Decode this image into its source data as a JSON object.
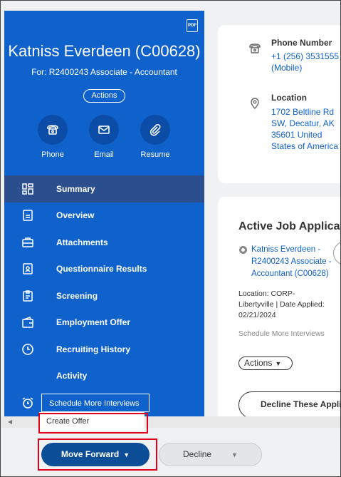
{
  "candidate": {
    "pdf_label": "PDF",
    "name": "Katniss Everdeen (C00628)",
    "for_line": "For: R2400243 Associate - Accountant",
    "actions_label": "Actions",
    "contact_buttons": [
      {
        "label": "Phone",
        "icon": "phone-icon"
      },
      {
        "label": "Email",
        "icon": "email-icon"
      },
      {
        "label": "Resume",
        "icon": "paperclip-icon"
      }
    ]
  },
  "nav": {
    "items": [
      {
        "label": "Summary",
        "icon": "grid-icon",
        "active": true
      },
      {
        "label": "Overview",
        "icon": "document-icon"
      },
      {
        "label": "Attachments",
        "icon": "briefcase-icon"
      },
      {
        "label": "Questionnaire Results",
        "icon": "person-card-icon"
      },
      {
        "label": "Screening",
        "icon": "clipboard-icon"
      },
      {
        "label": "Employment Offer",
        "icon": "wallet-icon"
      },
      {
        "label": "Recruiting History",
        "icon": "clock-icon"
      },
      {
        "label": "Activity",
        "icon": ""
      },
      {
        "label": "",
        "icon": "alarm-clock-icon"
      }
    ]
  },
  "popup": {
    "item1": "Schedule More Interviews",
    "item2": "Create Offer"
  },
  "contact_card": {
    "phone_label": "Phone Number",
    "phone_value": "+1 (256) 3531555\n(Mobile)",
    "location_label": "Location",
    "location_value": "1702 Beltline Rd\nSW, Decatur, AK\n35601 United\nStates of America"
  },
  "jobs_card": {
    "title": "Active Job Applications",
    "application_link": "Katniss Everdeen -\nR2400243 Associate -\nAccountant (C00628)",
    "location_line": "Location: CORP-\nLibertyville | Date Applied:\n02/21/2024",
    "schedule_text": "Schedule More Interviews",
    "actions_label": "Actions",
    "decline_label": "Decline These Applications"
  },
  "bottom": {
    "move_forward_label": "Move Forward",
    "decline_label": "Decline"
  },
  "colors": {
    "panel_blue": "#0f61cc",
    "active_nav": "#2b4e8c",
    "primary_button": "#0b4e97",
    "highlight_red": "#e0001b"
  }
}
